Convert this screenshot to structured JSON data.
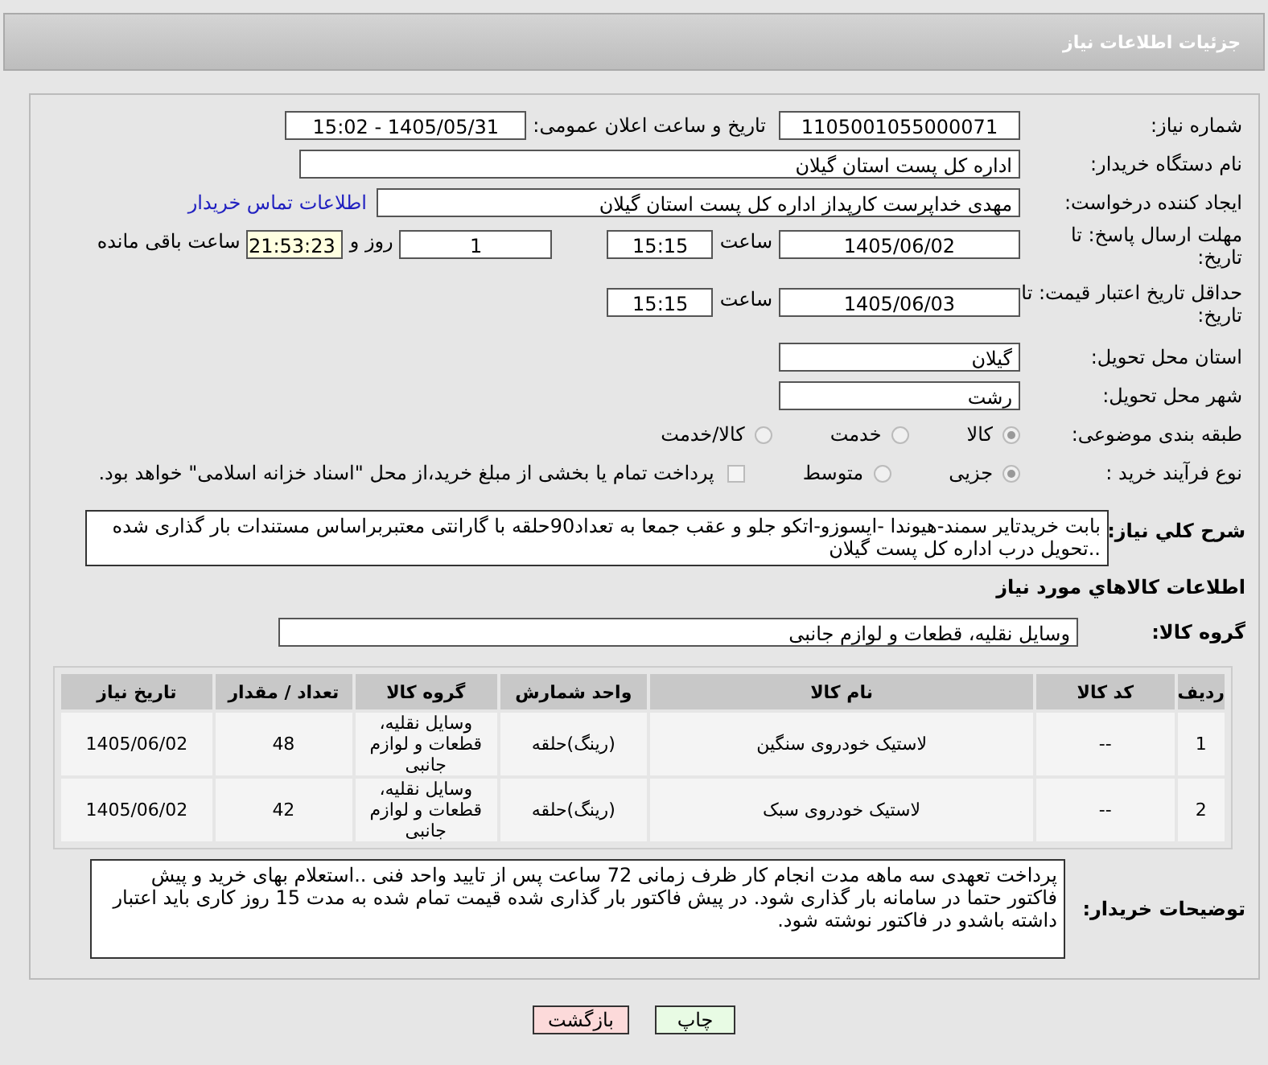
{
  "header": {
    "title": "جزئیات اطلاعات نیاز"
  },
  "need_number": {
    "label": "شماره نیاز:",
    "value": "1105001055000071"
  },
  "announce": {
    "label": "تاریخ و ساعت اعلان عمومی:",
    "value": "1405/05/31 - 15:02"
  },
  "buyer": {
    "label": "نام دستگاه خریدار:",
    "value": "اداره کل پست استان گیلان"
  },
  "creator": {
    "label": "ایجاد کننده درخواست:",
    "value": "مهدی  خداپرست  کارپداز  اداره کل پست استان گیلان",
    "link": "اطلاعات تماس خریدار"
  },
  "deadline": {
    "label": "مهلت ارسال پاسخ: تا تاریخ:",
    "date": "1405/06/02",
    "time_label": "ساعت",
    "time": "15:15",
    "days": "1",
    "days_label": "روز و",
    "remaining": "21:53:23",
    "remaining_label": "ساعت باقی مانده"
  },
  "validity": {
    "label": "حداقل تاریخ اعتبار قیمت: تا تاریخ:",
    "date": "1405/06/03",
    "time_label": "ساعت",
    "time": "15:15"
  },
  "province": {
    "label": "استان محل تحویل:",
    "value": "گیلان"
  },
  "city": {
    "label": "شهر محل تحویل:",
    "value": "رشت"
  },
  "category": {
    "label": "طبقه بندی موضوعی:",
    "options": [
      {
        "label": "کالا",
        "selected": true
      },
      {
        "label": "خدمت",
        "selected": false
      },
      {
        "label": "کالا/خدمت",
        "selected": false
      }
    ]
  },
  "process": {
    "label": "نوع فرآیند خرید :",
    "options": [
      {
        "label": "جزیی",
        "selected": true
      },
      {
        "label": "متوسط",
        "selected": false
      }
    ],
    "payment": {
      "checked": false,
      "text": "پرداخت تمام یا بخشی از مبلغ خرید،از محل \"اسناد خزانه اسلامی\" خواهد بود."
    }
  },
  "description": {
    "label": "شرح کلي نياز:",
    "value": "بابت خریدتایر سمند-هیوندا -ایسوزو-اتکو جلو و عقب جمعا به تعداد90حلقه با گارانتی معتبربراساس مستندات بار گذاری شده ..تحویل درب اداره کل پست گیلان"
  },
  "goods_heading": "اطلاعات کالاهاي مورد نياز",
  "goods_group": {
    "label": "گروه کالا:",
    "value": "وسایل نقلیه، قطعات و لوازم جانبی"
  },
  "table": {
    "columns": [
      "ردیف",
      "کد کالا",
      "نام کالا",
      "واحد شمارش",
      "گروه کالا",
      "تعداد / مقدار",
      "تاریخ نیاز"
    ],
    "rows": [
      [
        "1",
        "--",
        "لاستیک خودروی سنگین",
        "(رینگ)حلقه",
        "وسایل نقلیه، قطعات و لوازم جانبی",
        "48",
        "1405/06/02"
      ],
      [
        "2",
        "--",
        "لاستیک خودروی سبک",
        "(رینگ)حلقه",
        "وسایل نقلیه، قطعات و لوازم جانبی",
        "42",
        "1405/06/02"
      ]
    ]
  },
  "notes": {
    "label": "توضیحات خریدار:",
    "value": "پرداخت تعهدی سه ماهه مدت انجام کار ظرف زمانی 72 ساعت پس از تایید واحد فنی ..استعلام بهای خرید و پیش فاکتور حتما در سامانه بار گذاری شود. در پیش فاکتور بار گذاری شده قیمت تمام شده به مدت 15 روز کاری باید اعتبار داشته باشدو در فاکتور نوشته شود."
  },
  "buttons": [
    {
      "label": "چاپ",
      "kind": "print"
    },
    {
      "label": "بازگشت",
      "kind": "back"
    }
  ]
}
